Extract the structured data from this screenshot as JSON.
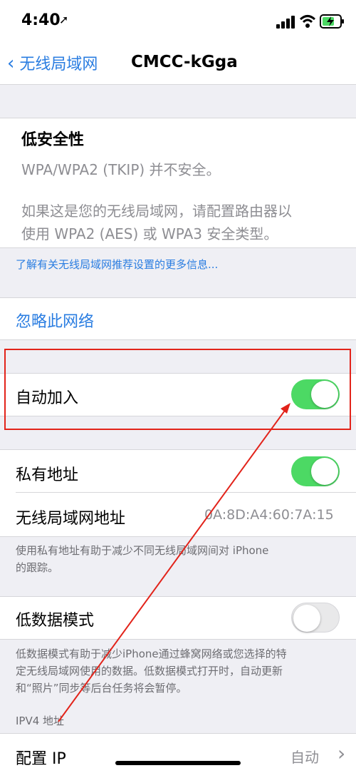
{
  "status": {
    "time": "4:40"
  },
  "nav": {
    "back_label": "无线局域网",
    "title": "CMCC-kGga"
  },
  "security": {
    "heading": "低安全性",
    "line1": "WPA/WPA2 (TKIP) 并不安全。",
    "line2": "如果这是您的无线局域网，请配置路由器以",
    "line3": "使用 WPA2 (AES) 或 WPA3 安全类型。"
  },
  "learn_more": "了解有关无线局域网推荐设置的更多信息...",
  "forget": "忽略此网络",
  "auto_join": {
    "label": "自动加入",
    "on": true
  },
  "private_address": {
    "label": "私有地址",
    "on": true
  },
  "wlan_address": {
    "label": "无线局域网地址",
    "value": "0A:8D:A4:60:7A:15"
  },
  "private_footer": {
    "line1": "使用私有地址有助于减少不同无线局域网间对 iPhone",
    "line2": "的跟踪。"
  },
  "low_data": {
    "label": "低数据模式",
    "on": false
  },
  "low_data_footer": {
    "line1": "低数据模式有助于减少iPhone通过蜂窝网络或您选择的特",
    "line2": "定无线局域网使用的数据。低数据模式打开时，自动更新",
    "line3": "和“照片”同步等后台任务将会暂停。"
  },
  "ipv4_header": "IPV4 地址",
  "configure_ip": {
    "label": "配置 IP",
    "value": "自动"
  },
  "colors": {
    "accent": "#2a7de1",
    "switch_on": "#4cd964",
    "annotation": "#e2231a"
  }
}
